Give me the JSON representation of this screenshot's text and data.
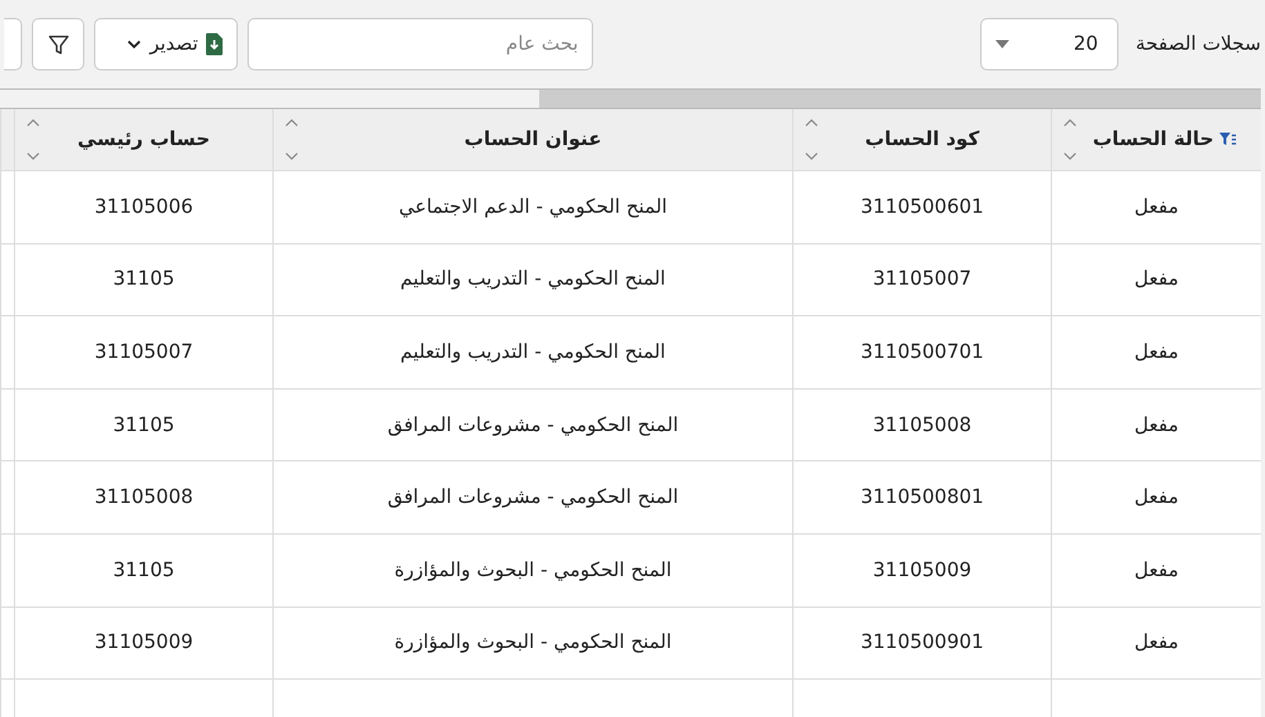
{
  "toolbar": {
    "page_size_label": "سجلات الصفحة",
    "page_size": "20",
    "search": {
      "placeholder": "بحث عام"
    },
    "export_button": "تصدير"
  },
  "table": {
    "columns": [
      {
        "label": "حالة الحساب",
        "filtered": true
      },
      {
        "label": "كود الحساب",
        "filtered": false
      },
      {
        "label": "عنوان الحساب",
        "filtered": false
      },
      {
        "label": "حساب رئيسي",
        "filtered": false
      }
    ],
    "rows": [
      [
        "مفعل",
        "3110500601",
        "المنح الحكومي - الدعم الاجتماعي",
        "31105006"
      ],
      [
        "مفعل",
        "31105007",
        "المنح الحكومي - التدريب والتعليم",
        "31105"
      ],
      [
        "مفعل",
        "3110500701",
        "المنح الحكومي - التدريب والتعليم",
        "31105007"
      ],
      [
        "مفعل",
        "31105008",
        "المنح الحكومي - مشروعات المرافق",
        "31105"
      ],
      [
        "مفعل",
        "3110500801",
        "المنح الحكومي - مشروعات المرافق",
        "31105008"
      ],
      [
        "مفعل",
        "31105009",
        "المنح الحكومي - البحوث والمؤازرة",
        "31105"
      ],
      [
        "مفعل",
        "3110500901",
        "المنح الحكومي - البحوث والمؤازرة",
        "31105009"
      ]
    ]
  }
}
